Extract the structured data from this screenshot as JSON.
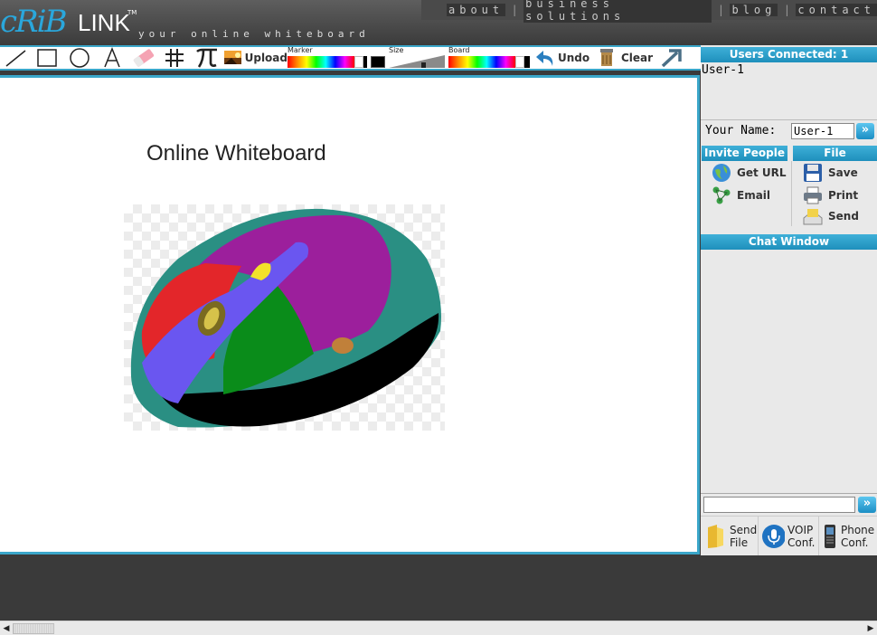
{
  "header": {
    "logo_mark": "cRiB",
    "logo_text": "LINK",
    "logo_tm": "TM",
    "tagline": "your online whiteboard",
    "nav": [
      "about",
      "business solutions",
      "blog",
      "contact"
    ]
  },
  "toolbar": {
    "upload_label": "Upload",
    "marker_label": "Marker",
    "size_label": "Size",
    "board_label": "Board",
    "undo_label": "Undo",
    "clear_label": "Clear"
  },
  "canvas": {
    "title": "Online Whiteboard"
  },
  "sidebar": {
    "users_header": "Users Connected: 1",
    "users": [
      "User-1"
    ],
    "name_label": "Your Name:",
    "name_value": "User-1",
    "invite_header": "Invite People",
    "file_header": "File",
    "invite_items": [
      "Get URL",
      "Email"
    ],
    "file_items": [
      "Save",
      "Print",
      "Send"
    ],
    "chat_header": "Chat Window",
    "bottom_buttons": [
      {
        "line1": "Send",
        "line2": "File"
      },
      {
        "line1": "VOIP",
        "line2": "Conf."
      },
      {
        "line1": "Phone",
        "line2": "Conf."
      }
    ]
  },
  "colors": {
    "accent": "#3aa6c9",
    "header_bg": "#4a4a4a",
    "bar_blue": "#1e8fbc"
  }
}
